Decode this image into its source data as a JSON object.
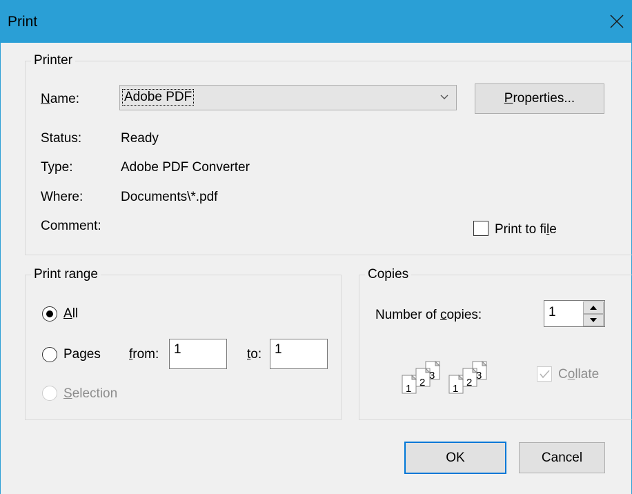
{
  "window": {
    "title": "Print"
  },
  "printer": {
    "group_label": "Printer",
    "name_label": "Name:",
    "name_value": "Adobe PDF",
    "properties_label": "Properties...",
    "status_label": "Status:",
    "status_value": "Ready",
    "type_label": "Type:",
    "type_value": "Adobe PDF Converter",
    "where_label": "Where:",
    "where_value": "Documents\\*.pdf",
    "comment_label": "Comment:",
    "comment_value": "",
    "print_to_file_label": "Print to file",
    "print_to_file_checked": false
  },
  "print_range": {
    "group_label": "Print range",
    "all_label": "All",
    "pages_label": "Pages",
    "from_label": "from:",
    "from_value": "1",
    "to_label": "to:",
    "to_value": "1",
    "selection_label": "Selection",
    "selected": "All"
  },
  "copies": {
    "group_label": "Copies",
    "number_label": "Number of copies:",
    "number_value": "1",
    "collate_label": "Collate",
    "collate_checked": true,
    "collate_digits": [
      "1",
      "2",
      "3"
    ]
  },
  "buttons": {
    "ok_label": "OK",
    "cancel_label": "Cancel"
  }
}
